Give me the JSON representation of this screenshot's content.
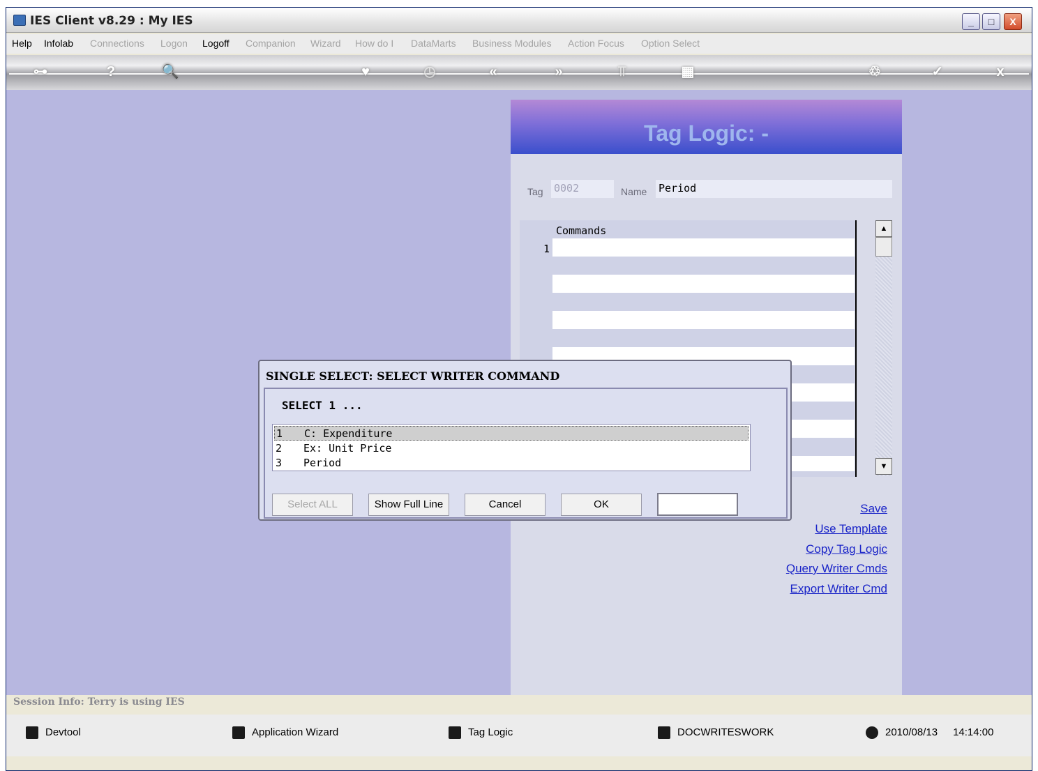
{
  "app": {
    "title": "IES Client v8.29 : My IES",
    "window_buttons": {
      "minimize": "_",
      "maximize": "□",
      "close": "X"
    }
  },
  "menu": [
    {
      "label": "Help",
      "enabled": true
    },
    {
      "label": "Infolab",
      "enabled": true
    },
    {
      "label": "Connections",
      "enabled": false
    },
    {
      "label": "Logon",
      "enabled": false
    },
    {
      "label": "Logoff",
      "enabled": true
    },
    {
      "label": "Companion",
      "enabled": false
    },
    {
      "label": "Wizard",
      "enabled": false
    },
    {
      "label": "How do I",
      "enabled": false
    },
    {
      "label": "DataMarts",
      "enabled": false
    },
    {
      "label": "Business Modules",
      "enabled": false
    },
    {
      "label": "Action Focus",
      "enabled": false
    },
    {
      "label": "Option Select",
      "enabled": false
    }
  ],
  "toolbar": {
    "icons": [
      "key-icon",
      "help-icon",
      "search-icon",
      "heart-icon",
      "clock-icon",
      "back-icon",
      "forward-icon",
      "tree-icon",
      "grid-icon",
      "recycle-icon",
      "check-icon",
      "close-icon"
    ],
    "glyphs": {
      "key": "⊶",
      "help": "?",
      "search": "🔍",
      "heart": "♥",
      "clock": "◷",
      "back": "«",
      "forward": "»",
      "tree": "⫪",
      "grid": "▦",
      "recycle": "♲",
      "check": "✓",
      "close": "x"
    }
  },
  "panel": {
    "title": "Tag Logic: -",
    "tag_label": "Tag",
    "tag_value": "0002",
    "name_label": "Name",
    "name_value": "Period",
    "grid_header": "Commands",
    "row_number": "1"
  },
  "links": [
    "Save",
    "Use Template",
    "Copy Tag Logic",
    "Query Writer Cmds",
    "Export Writer Cmd"
  ],
  "dialog": {
    "title": "SINGLE SELECT: SELECT WRITER COMMAND",
    "prompt": "SELECT 1 ...",
    "items": [
      {
        "num": "1",
        "text": "C: Expenditure",
        "selected": true
      },
      {
        "num": "2",
        "text": "Ex: Unit Price",
        "selected": false
      },
      {
        "num": "3",
        "text": "Period",
        "selected": false
      }
    ],
    "buttons": {
      "select_all": "Select ALL",
      "show_full_line": "Show Full Line",
      "cancel": "Cancel",
      "ok": "OK"
    },
    "input_value": ""
  },
  "session_info": "Session Info: Terry is using IES",
  "statusbar": {
    "devtool": "Devtool",
    "app_wizard": "Application Wizard",
    "tag_logic": "Tag Logic",
    "db": "DOCWRITESWORK",
    "date": "2010/08/13",
    "time": "14:14:00"
  }
}
